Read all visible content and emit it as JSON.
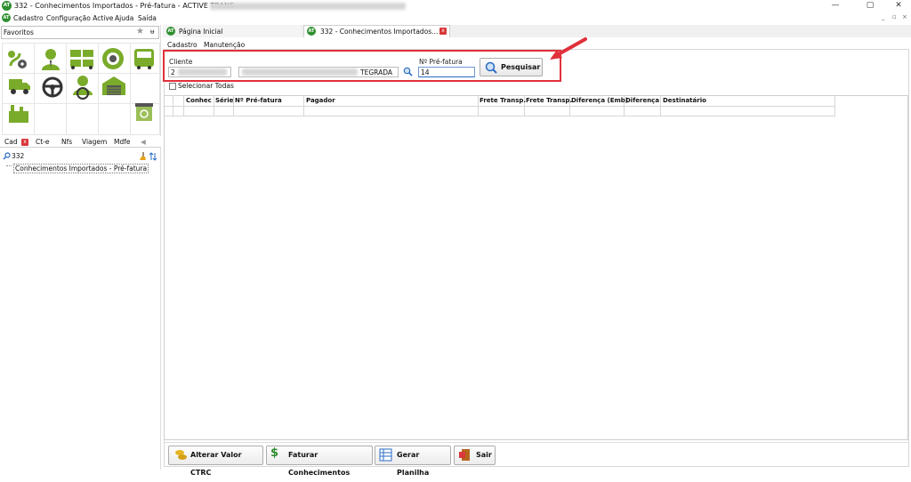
{
  "window": {
    "title": "332 - Conhecimentos Importados - Pré-fatura - ACTIVE TRANS -",
    "logo_text": "AT",
    "controls": [
      "—",
      "▢",
      "✕"
    ]
  },
  "menubar": {
    "items": [
      "Cadastro",
      "Configuração Active",
      "Ajuda",
      "Saída"
    ],
    "mdi_controls": [
      "_",
      "▫",
      "×"
    ]
  },
  "favorites": {
    "label": "Favoritos",
    "star": "★",
    "pin": "ᵾ"
  },
  "left_tabs": {
    "items": [
      "Cad",
      "Ct-e",
      "Nfs",
      "Viagem",
      "Mdfe"
    ],
    "close": "x",
    "scroll": "◀"
  },
  "search": {
    "value": "332"
  },
  "tree": {
    "item": "Conhecimentos Importados - Pré-fatura"
  },
  "doc_tabs": {
    "home": "Página Inicial",
    "active": "332 - Conhecimentos Importados...",
    "close": "x"
  },
  "sub_tabs": [
    "Cadastro",
    "Manutenção"
  ],
  "form": {
    "cliente_label": "Cliente",
    "cliente_code": "2",
    "cliente_name": "TEGRADA",
    "prefatura_label": "Nº Pré-fatura",
    "prefatura_value": "14",
    "search_button": "Pesquisar"
  },
  "select_all": "Selecionar Todas",
  "table": {
    "columns": [
      "Conhec",
      "Série",
      "Nº Pré-fatura",
      "Pagador",
      "Frete Transp.",
      "Frete Transp.",
      "Diferença (Emb)",
      "Diferença",
      "Destinatário"
    ]
  },
  "bottom_buttons": [
    "Alterar Valor CTRC",
    "Faturar Conhecimentos",
    "Gerar Planilha",
    "Sair"
  ],
  "colors": {
    "highlight": "#e0303a",
    "arrow": "#e0303a",
    "logo": "#2f8f2f",
    "icon_green": "#7aab2a"
  },
  "icons": {
    "favorites": [
      "route-add-icon",
      "user-icon",
      "trucks-icon",
      "wheel-badge-icon",
      "bus-icon",
      "truck-icon",
      "steering-wheel-icon",
      "driver-icon",
      "warehouse-icon",
      "factory-icon",
      "recycle-bin-icon"
    ]
  }
}
